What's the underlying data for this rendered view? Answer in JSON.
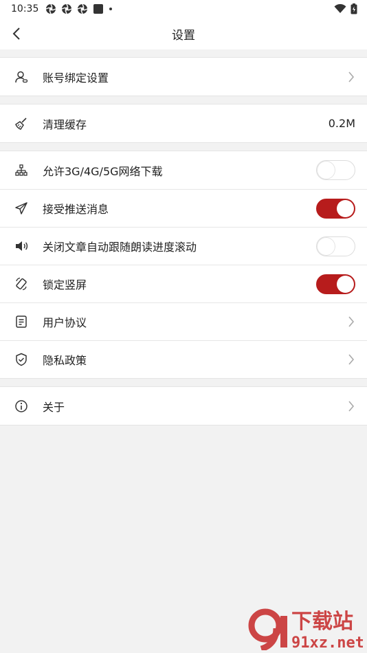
{
  "status_bar": {
    "time": "10:35"
  },
  "header": {
    "title": "设置"
  },
  "groups": [
    {
      "items": [
        {
          "label": "账号绑定设置"
        }
      ]
    },
    {
      "items": [
        {
          "label": "清理缓存",
          "value": "0.2M"
        }
      ]
    },
    {
      "items": [
        {
          "label": "允许3G/4G/5G网络下载",
          "toggle_on": false
        },
        {
          "label": "接受推送消息",
          "toggle_on": true
        },
        {
          "label": "关闭文章自动跟随朗读进度滚动",
          "toggle_on": false
        },
        {
          "label": "锁定竖屏",
          "toggle_on": true
        },
        {
          "label": "用户协议"
        },
        {
          "label": "隐私政策"
        }
      ]
    },
    {
      "items": [
        {
          "label": "关于"
        }
      ]
    }
  ],
  "watermark": {
    "logo_text": "9",
    "text_top": "下载站",
    "text_bottom": "91xz.net"
  },
  "colors": {
    "accent": "#b71c1c",
    "background": "#f2f2f2",
    "watermark": "#c62828"
  }
}
